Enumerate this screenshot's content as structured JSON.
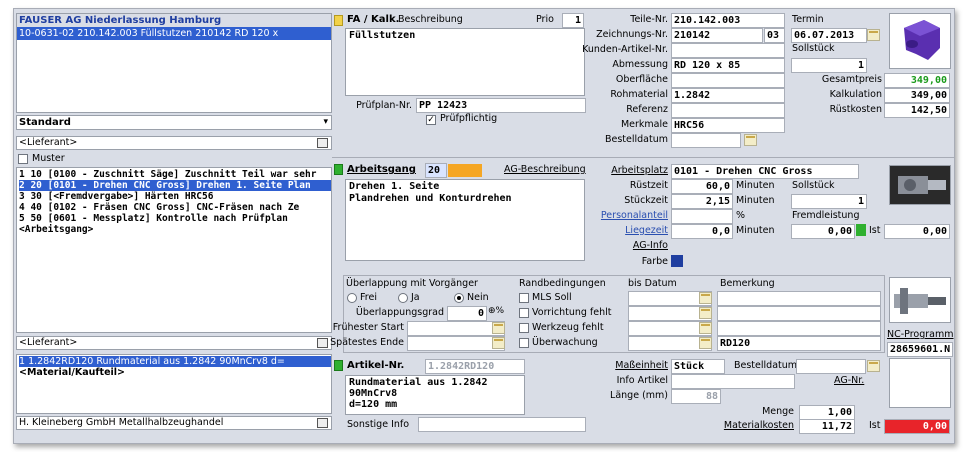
{
  "left": {
    "company": "FAUSER AG Niederlassung Hamburg",
    "order_line": "10-0631-02 210.142.003 Füllstutzen 210142  RD 120 x",
    "standard": "Standard",
    "lieferant1": "<Lieferant>",
    "muster": "Muster",
    "operations": [
      "1  10  [0100 - Zuschnitt Säge] Zuschnitt Teil war sehr",
      "2  20  [0101 - Drehen CNC Gross] Drehen 1. Seite Plan",
      "3  30  [<Fremdvergabe>] Härten HRC56",
      "4  40  [0102 - Fräsen CNC Gross] CNC-Fräsen nach Ze",
      "5  50  [0601 - Messplatz] Kontrolle nach Prüfplan",
      "<Arbeitsgang>"
    ],
    "lieferant2": "<Lieferant>",
    "material_lines": [
      "1 1.2842RD120 Rundmaterial aus 1.2842 90MnCrv8 d=",
      "<Material/Kaufteil>"
    ],
    "supplier": "H. Kleineberg GmbH Metallhalbzeughandel"
  },
  "fa": {
    "title": "FA / Kalk.",
    "beschreibung_label": "Beschreibung",
    "prio_label": "Prio",
    "prio": "1",
    "description": "Füllstutzen",
    "pruefplan_label": "Prüfplan-Nr.",
    "pruefplan": "PP 12423",
    "pruefpflichtig_label": "Prüfpflichtig"
  },
  "part": {
    "teile_nr_label": "Teile-Nr.",
    "teile_nr": "210.142.003",
    "zeichnungs_label": "Zeichnungs-Nr.",
    "zeichnungs": "210142",
    "zeichnungs_idx": "03",
    "kunden_label": "Kunden-Artikel-Nr.",
    "abmessung_label": "Abmessung",
    "abmessung": "RD 120 x 85",
    "oberflaeche_label": "Oberfläche",
    "rohmaterial_label": "Rohmaterial",
    "rohmaterial": "1.2842",
    "referenz_label": "Referenz",
    "merkmale_label": "Merkmale",
    "merkmale": "HRC56",
    "bestelldatum_label": "Bestelldatum"
  },
  "termin": {
    "label": "Termin",
    "date": "06.07.2013",
    "sollstueck_label": "Sollstück",
    "sollstueck": "1",
    "gesamtpreis_label": "Gesamtpreis",
    "gesamtpreis": "349,00",
    "kalkulation_label": "Kalkulation",
    "kalkulation": "349,00",
    "ruestkosten_label": "Rüstkosten",
    "ruestkosten": "142,50"
  },
  "arbeitsgang": {
    "title": "Arbeitsgang",
    "number": "20",
    "ag_beschreibung": "AG-Beschreibung",
    "text_line1": "Drehen 1. Seite",
    "text_line2": "Plandrehen und Konturdrehen",
    "arbeitsplatz_label": "Arbeitsplatz",
    "arbeitsplatz": "0101 - Drehen CNC Gross",
    "ruestzeit_label": "Rüstzeit",
    "ruestzeit": "60,0",
    "minuten": "Minuten",
    "stueckzeit_label": "Stückzeit",
    "stueckzeit": "2,15",
    "personalanteil_label": "Personalanteil",
    "percent": "%",
    "liegezeit_label": "Liegezeit",
    "liegezeit": "0,0",
    "ag_info": "AG-Info",
    "farbe": "Farbe",
    "sollstueck_label": "Sollstück",
    "sollstueck": "1",
    "fremdleistung_label": "Fremdleistung",
    "fremdleistung": "0,00",
    "ist_label": "Ist",
    "ist_value": "0,00"
  },
  "ueberlappung": {
    "title": "Überlappung mit Vorgänger",
    "frei": "Frei",
    "ja": "Ja",
    "nein": "Nein",
    "grad_label": "Überlappungsgrad",
    "grad": "0",
    "fruehester_label": "Frühester Start",
    "spaetestes_label": "Spätestes Ende",
    "rand_label": "Randbedingungen",
    "bis_label": "bis Datum",
    "bemerkung_label": "Bemerkung",
    "mls": "MLS Soll",
    "vorrichtung": "Vorrichtung fehlt",
    "werkzeug": "Werkzeug fehlt",
    "ueberwachung": "Überwachung",
    "bemerkung_value": "RD120",
    "nc_label": "NC-Programm",
    "nc_value": "28659601.N"
  },
  "artikel": {
    "label": "Artikel-Nr.",
    "number": "1.2842RD120",
    "desc1": "Rundmaterial aus 1.2842",
    "desc2": "90MnCrv8",
    "desc3": "d=120 mm",
    "sonstige_label": "Sonstige Info",
    "masseinheit_label": "Maßeinheit",
    "masseinheit": "Stück",
    "bestelldatum_label": "Bestelldatum",
    "ag_nr": "AG-Nr.",
    "info_artikel_label": "Info Artikel",
    "laenge_label": "Länge (mm)",
    "laenge": "88",
    "menge_label": "Menge",
    "menge": "1,00",
    "materialkosten_label": "Materialkosten",
    "materialkosten": "11,72",
    "ist_label": "Ist",
    "ist_value": "0,00"
  },
  "colors": {
    "selection": "#2f5fd0",
    "header_text": "#1f3ea0",
    "green": "#1a9a1a",
    "red_alert": "#e8242a",
    "orange": "#f5a623",
    "farbe_swatch": "#1f3ea0"
  }
}
